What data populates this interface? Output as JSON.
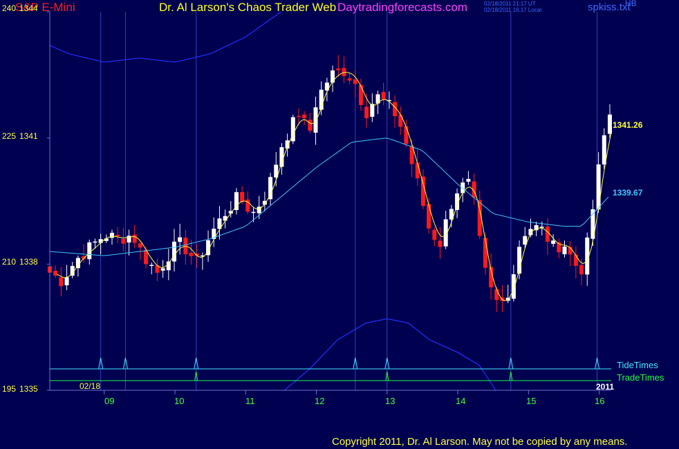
{
  "header": {
    "instrument": "S&P E-Mini",
    "title": "Dr. Al Larson's Chaos Trader Web",
    "site": "Daytradingforecasts.com",
    "time_ut": "02/18/2011 21:17 UT",
    "time_local": "02/18/2011 16:17 Local",
    "filename": "spkiss.txt",
    "hb": "HB"
  },
  "colors": {
    "background": "#000050",
    "frame": "#7070d0",
    "bull_candle": "#ffffff",
    "bear_candle": "#ff1a1a",
    "fast_ma": "#ffff40",
    "slow_ma": "#40c8ff",
    "envelope": "#2030ff",
    "tide_times": "#40e8ff",
    "trade_times": "#20ff40",
    "title_red": "#ff2020",
    "title_yellow": "#ffff20",
    "site_magenta": "#ff40ff",
    "file_blue": "#3c6cff",
    "day_labels": "#40ff40",
    "axis_labels": "#ffff40",
    "copyright": "#ffff40"
  },
  "footer": {
    "copyright": "Copyright 2011, Dr. Al Larson. May not be copied by any means."
  },
  "chart_data": {
    "type": "candlestick",
    "title": "S&P E-Mini",
    "y_axis": {
      "range": [
        1335,
        1344
      ],
      "ticks": [
        {
          "label": "240",
          "price": "1344",
          "value": 1344
        },
        {
          "label": "225",
          "price": "1341",
          "value": 1341
        },
        {
          "label": "210",
          "price": "1338",
          "value": 1338
        },
        {
          "label": "195",
          "price": "1335",
          "value": 1335
        }
      ]
    },
    "x_axis": {
      "range": [
        8.23,
        16.17
      ],
      "ticks": [
        {
          "label": "09",
          "x": 9
        },
        {
          "label": "10",
          "x": 10
        },
        {
          "label": "11",
          "x": 11
        },
        {
          "label": "12",
          "x": 12
        },
        {
          "label": "13",
          "x": 13
        },
        {
          "label": "14",
          "x": 14
        },
        {
          "label": "15",
          "x": 15
        },
        {
          "label": "16",
          "x": 16
        }
      ]
    },
    "date_label": "02/18",
    "year_label": "2011",
    "series_labels": {
      "tide": "TideTimes",
      "trade": "TradeTimes"
    },
    "last_values": {
      "fast": "1341.26",
      "slow": "1339.67"
    },
    "time_lines": [
      8.95,
      9.3,
      10.3,
      12.55,
      13.0,
      14.75,
      15.97
    ],
    "tide_times": [
      8.95,
      9.3,
      10.3,
      12.55,
      13.0,
      14.75,
      15.97
    ],
    "trade_times": [
      10.3,
      13.0,
      14.75
    ],
    "anchors": [
      [
        8.23,
        1337.8
      ],
      [
        8.4,
        1337.6
      ],
      [
        8.6,
        1338.1
      ],
      [
        8.8,
        1338.4
      ],
      [
        9.0,
        1338.7
      ],
      [
        9.2,
        1338.6
      ],
      [
        9.4,
        1338.7
      ],
      [
        9.55,
        1338.2
      ],
      [
        9.75,
        1337.8
      ],
      [
        9.9,
        1338.2
      ],
      [
        10.05,
        1338.5
      ],
      [
        10.2,
        1338.3
      ],
      [
        10.3,
        1338.0
      ],
      [
        10.5,
        1338.7
      ],
      [
        10.7,
        1339.2
      ],
      [
        10.9,
        1339.6
      ],
      [
        11.1,
        1339.2
      ],
      [
        11.3,
        1339.7
      ],
      [
        11.5,
        1340.8
      ],
      [
        11.75,
        1341.6
      ],
      [
        11.9,
        1341.1
      ],
      [
        12.0,
        1341.9
      ],
      [
        12.2,
        1342.5
      ],
      [
        12.4,
        1342.6
      ],
      [
        12.55,
        1342.3
      ],
      [
        12.7,
        1341.6
      ],
      [
        12.85,
        1342.0
      ],
      [
        13.0,
        1341.8
      ],
      [
        13.15,
        1341.5
      ],
      [
        13.3,
        1340.7
      ],
      [
        13.45,
        1339.8
      ],
      [
        13.6,
        1338.8
      ],
      [
        13.75,
        1338.5
      ],
      [
        13.9,
        1339.4
      ],
      [
        14.0,
        1339.8
      ],
      [
        14.15,
        1339.9
      ],
      [
        14.25,
        1339.3
      ],
      [
        14.35,
        1338.0
      ],
      [
        14.5,
        1337.2
      ],
      [
        14.6,
        1337.0
      ],
      [
        14.75,
        1337.5
      ],
      [
        14.9,
        1338.7
      ],
      [
        15.05,
        1338.9
      ],
      [
        15.2,
        1338.8
      ],
      [
        15.35,
        1338.4
      ],
      [
        15.5,
        1338.5
      ],
      [
        15.65,
        1338.0
      ],
      [
        15.75,
        1337.9
      ],
      [
        15.85,
        1338.6
      ],
      [
        15.95,
        1339.8
      ],
      [
        16.05,
        1340.9
      ],
      [
        16.17,
        1341.7
      ]
    ],
    "slow_ma_anchors": [
      [
        8.23,
        1338.3
      ],
      [
        9.0,
        1338.2
      ],
      [
        10.0,
        1338.4
      ],
      [
        10.5,
        1338.6
      ],
      [
        11.0,
        1338.9
      ],
      [
        11.5,
        1339.6
      ],
      [
        12.0,
        1340.3
      ],
      [
        12.5,
        1340.9
      ],
      [
        13.0,
        1341.0
      ],
      [
        13.5,
        1340.7
      ],
      [
        14.0,
        1339.9
      ],
      [
        14.5,
        1339.2
      ],
      [
        15.0,
        1339.0
      ],
      [
        15.5,
        1338.9
      ],
      [
        15.75,
        1338.9
      ],
      [
        16.17,
        1339.67
      ]
    ],
    "upper_band_anchors": [
      [
        8.23,
        1343.2
      ],
      [
        8.5,
        1343.0
      ],
      [
        9.0,
        1342.8
      ],
      [
        9.5,
        1342.9
      ],
      [
        10.0,
        1342.8
      ],
      [
        10.5,
        1343.0
      ],
      [
        11.0,
        1343.4
      ],
      [
        11.5,
        1344.0
      ],
      [
        12.0,
        1344.8
      ],
      [
        12.6,
        1345.2
      ],
      [
        13.2,
        1344.9
      ],
      [
        13.7,
        1344.6
      ],
      [
        14.3,
        1344.3
      ],
      [
        15.0,
        1344.3
      ],
      [
        15.5,
        1344.2
      ],
      [
        15.8,
        1344.0
      ],
      [
        16.0,
        1344.3
      ],
      [
        16.17,
        1344.8
      ]
    ],
    "lower_band_anchors": [
      [
        11.55,
        1335.0
      ],
      [
        11.9,
        1335.5
      ],
      [
        12.3,
        1336.2
      ],
      [
        12.7,
        1336.6
      ],
      [
        13.0,
        1336.7
      ],
      [
        13.3,
        1336.6
      ],
      [
        13.6,
        1336.2
      ],
      [
        14.0,
        1335.9
      ],
      [
        14.3,
        1335.6
      ],
      [
        14.5,
        1335.1
      ],
      [
        14.6,
        1334.8
      ]
    ]
  }
}
